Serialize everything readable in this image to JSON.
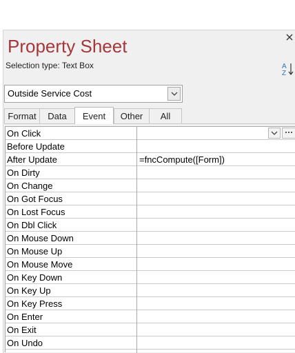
{
  "window": {
    "title": "Property Sheet",
    "selection_type_label": "Selection type:",
    "selection_type_value": "Text Box"
  },
  "object_selector": {
    "value": "Outside Service Cost"
  },
  "tabs": [
    {
      "label": "Format",
      "active": false
    },
    {
      "label": "Data",
      "active": false
    },
    {
      "label": "Event",
      "active": true
    },
    {
      "label": "Other",
      "active": false
    },
    {
      "label": "All",
      "active": false
    }
  ],
  "properties": [
    {
      "name": "On Click",
      "value": ""
    },
    {
      "name": "Before Update",
      "value": ""
    },
    {
      "name": "After Update",
      "value": "=fncCompute([Form])"
    },
    {
      "name": "On Dirty",
      "value": ""
    },
    {
      "name": "On Change",
      "value": ""
    },
    {
      "name": "On Got Focus",
      "value": ""
    },
    {
      "name": "On Lost Focus",
      "value": ""
    },
    {
      "name": "On Dbl Click",
      "value": ""
    },
    {
      "name": "On Mouse Down",
      "value": ""
    },
    {
      "name": "On Mouse Up",
      "value": ""
    },
    {
      "name": "On Mouse Move",
      "value": ""
    },
    {
      "name": "On Key Down",
      "value": ""
    },
    {
      "name": "On Key Up",
      "value": ""
    },
    {
      "name": "On Key Press",
      "value": ""
    },
    {
      "name": "On Enter",
      "value": ""
    },
    {
      "name": "On Exit",
      "value": ""
    },
    {
      "name": "On Undo",
      "value": ""
    }
  ],
  "colors": {
    "title": "#a4373a",
    "sort_icon": "#2e75b6"
  },
  "icons": {
    "close": "close-icon",
    "sort": "sort-az-icon",
    "dropdown": "chevron-down-icon",
    "builder": "ellipsis-icon"
  }
}
